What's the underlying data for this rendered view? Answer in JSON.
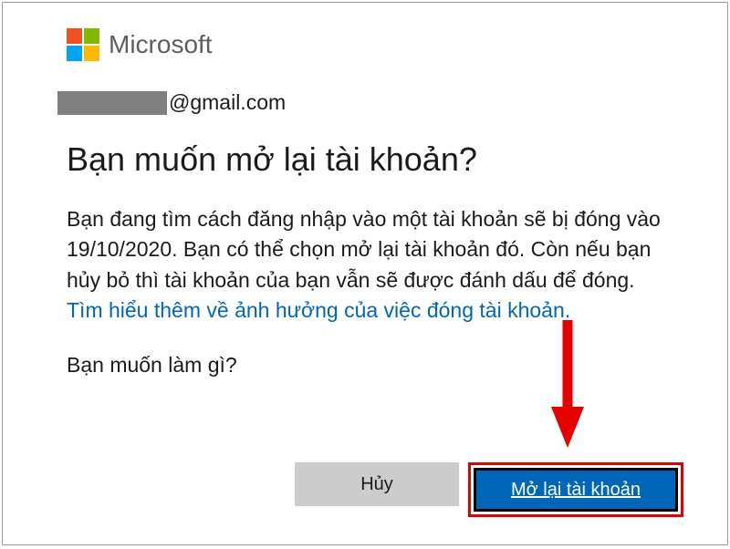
{
  "brand": "Microsoft",
  "email": {
    "domain": "@gmail.com"
  },
  "heading": "Bạn muốn mở lại tài khoản?",
  "body": {
    "part1": "Bạn đang tìm cách đăng nhập vào một tài khoản sẽ bị đóng vào 19/10/2020. Bạn có thể chọn mở lại tài khoản đó. Còn nếu bạn hủy bỏ thì tài khoản của bạn vẫn sẽ được đánh dấu để đóng. ",
    "link": "Tìm hiểu thêm về ảnh hưởng của việc đóng tài khoản."
  },
  "question": "Bạn muốn làm gì?",
  "buttons": {
    "cancel": "Hủy",
    "reopen": "Mở lại tài khoản"
  },
  "colors": {
    "primary": "#0067b8",
    "highlight": "#e60000"
  }
}
